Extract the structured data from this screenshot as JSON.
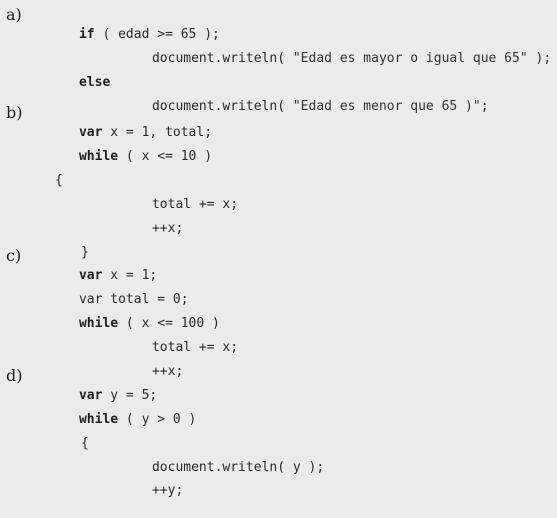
{
  "exercise": {
    "a": {
      "label": "a)",
      "lines": [
        {
          "kw": "if",
          "rest": " ( edad >= 65 );"
        },
        {
          "pre": "document.writeln( ",
          "str": "\"Edad es mayor o igual que 65\"",
          "post": " );"
        },
        {
          "kw": "else",
          "rest": ""
        },
        {
          "pre": "document.writeln( ",
          "str": "\"Edad es menor que 65 )\"",
          "post": ";"
        }
      ]
    },
    "b": {
      "label": "b)",
      "lines": [
        {
          "kw": "var",
          "rest": " x = 1, total;"
        },
        {
          "kw": "while",
          "rest": " ( x <= 10 )"
        },
        {
          "text": "{"
        },
        {
          "text": "total += x;"
        },
        {
          "text": "++x;"
        },
        {
          "text": "}"
        }
      ]
    },
    "c": {
      "label": "c)",
      "lines": [
        {
          "kw": "var",
          "rest": " x = 1;"
        },
        {
          "text": "var total = 0;"
        },
        {
          "kw": "while",
          "rest": " ( x <= 100 )"
        },
        {
          "text": "total += x;"
        },
        {
          "text": "++x;"
        }
      ]
    },
    "d": {
      "label": "d)",
      "lines": [
        {
          "kw": "var",
          "rest": " y = 5;"
        },
        {
          "kw": "while",
          "rest": " ( y > 0 )"
        },
        {
          "text": "{"
        },
        {
          "text": "document.writeln( y );"
        },
        {
          "text": "++y;"
        }
      ]
    }
  }
}
